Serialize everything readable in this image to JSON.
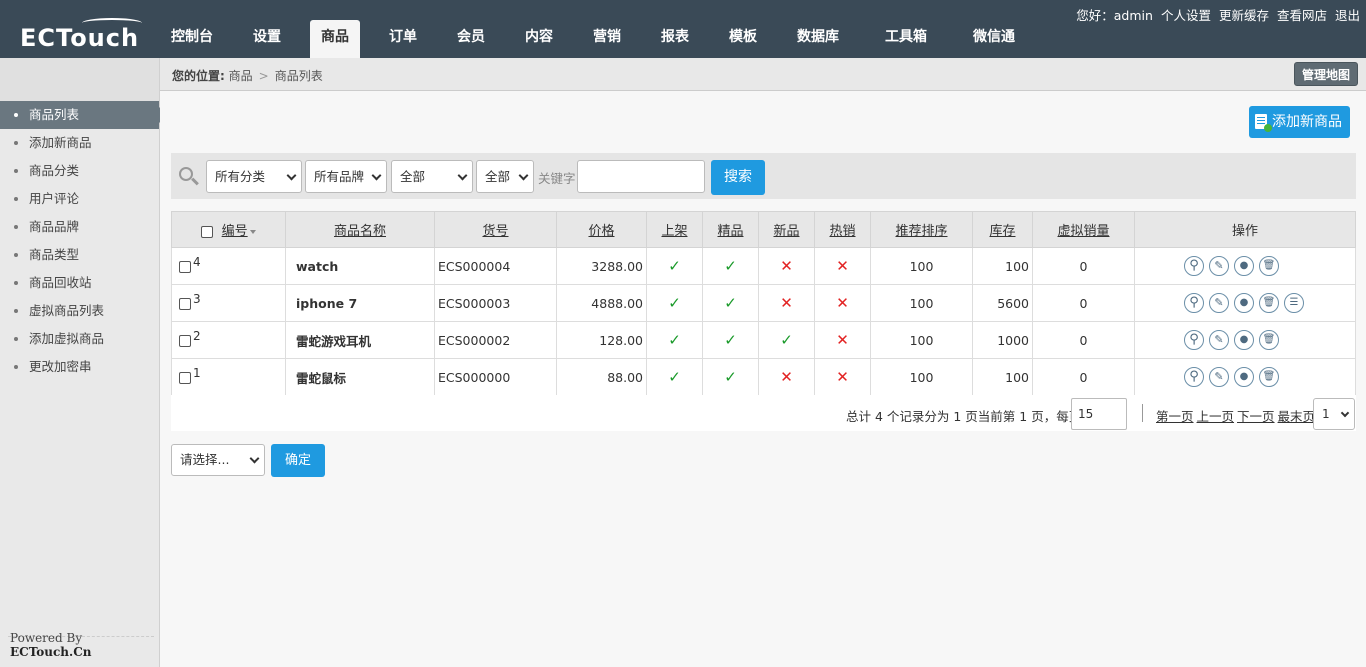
{
  "header": {
    "logo": "ECTouch",
    "nav": [
      {
        "label": "控制台",
        "active": false
      },
      {
        "label": "设置",
        "active": false
      },
      {
        "label": "商品",
        "active": true
      },
      {
        "label": "订单",
        "active": false
      },
      {
        "label": "会员",
        "active": false
      },
      {
        "label": "内容",
        "active": false
      },
      {
        "label": "营销",
        "active": false
      },
      {
        "label": "报表",
        "active": false
      },
      {
        "label": "模板",
        "active": false
      },
      {
        "label": "数据库",
        "active": false
      },
      {
        "label": "工具箱",
        "active": false
      },
      {
        "label": "微信通",
        "active": false
      }
    ],
    "greeting": "您好：admin",
    "links": [
      "个人设置",
      "更新缓存",
      "查看网店",
      "退出"
    ]
  },
  "breadcrumb": {
    "label": "您的位置:",
    "items": [
      "商品",
      "商品列表"
    ],
    "map_button": "管理地图"
  },
  "sidebar": {
    "items": [
      {
        "label": "商品列表",
        "active": true
      },
      {
        "label": "添加新商品",
        "active": false
      },
      {
        "label": "商品分类",
        "active": false
      },
      {
        "label": "用户评论",
        "active": false
      },
      {
        "label": "商品品牌",
        "active": false
      },
      {
        "label": "商品类型",
        "active": false
      },
      {
        "label": "商品回收站",
        "active": false
      },
      {
        "label": "虚拟商品列表",
        "active": false
      },
      {
        "label": "添加虚拟商品",
        "active": false
      },
      {
        "label": "更改加密串",
        "active": false
      }
    ],
    "powered_prefix": "Powered By",
    "powered_brand": "ECTouch.Cn"
  },
  "toolbar": {
    "add_button": "添加新商品"
  },
  "filters": {
    "category": "所有分类",
    "brand": "所有品牌",
    "type": "全部",
    "status": "全部",
    "keyword_label": "关键字",
    "keyword_value": "",
    "search_button": "搜索"
  },
  "table": {
    "columns": [
      "编号",
      "商品名称",
      "货号",
      "价格",
      "上架",
      "精品",
      "新品",
      "热销",
      "推荐排序",
      "库存",
      "虚拟销量",
      "操作"
    ],
    "rows": [
      {
        "id": "4",
        "name": "watch",
        "sn": "ECS000004",
        "price": "3288.00",
        "on_sale": true,
        "best": true,
        "new": false,
        "hot": false,
        "sort": "100",
        "stock": "100",
        "virtual_sales": "0",
        "ops": [
          "view-icon",
          "edit-icon",
          "copy-icon",
          "delete-icon"
        ]
      },
      {
        "id": "3",
        "name": "iphone 7",
        "sn": "ECS000003",
        "price": "4888.00",
        "on_sale": true,
        "best": true,
        "new": false,
        "hot": false,
        "sort": "100",
        "stock": "5600",
        "virtual_sales": "0",
        "ops": [
          "view-icon",
          "edit-icon",
          "copy-icon",
          "delete-icon",
          "product-list-icon"
        ]
      },
      {
        "id": "2",
        "name": "雷蛇游戏耳机",
        "sn": "ECS000002",
        "price": "128.00",
        "on_sale": true,
        "best": true,
        "new": true,
        "hot": false,
        "sort": "100",
        "stock": "1000",
        "virtual_sales": "0",
        "ops": [
          "view-icon",
          "edit-icon",
          "copy-icon",
          "delete-icon"
        ]
      },
      {
        "id": "1",
        "name": "雷蛇鼠标",
        "sn": "ECS000000",
        "price": "88.00",
        "on_sale": true,
        "best": true,
        "new": false,
        "hot": false,
        "sort": "100",
        "stock": "100",
        "virtual_sales": "0",
        "ops": [
          "view-icon",
          "edit-icon",
          "copy-icon",
          "delete-icon"
        ]
      }
    ]
  },
  "pager": {
    "summary": "总计 4 个记录分为 1 页当前第 1 页，每页",
    "per_page": "15",
    "first": "第一页",
    "prev": "上一页",
    "next": "下一页",
    "last": "最末页",
    "page": "1"
  },
  "batch": {
    "select_placeholder": "请选择...",
    "ok_button": "确定"
  },
  "colors": {
    "header_bg": "#3a4a57",
    "accent": "#1f9ae0",
    "check": "#1a9a2a",
    "cross": "#e22222"
  }
}
